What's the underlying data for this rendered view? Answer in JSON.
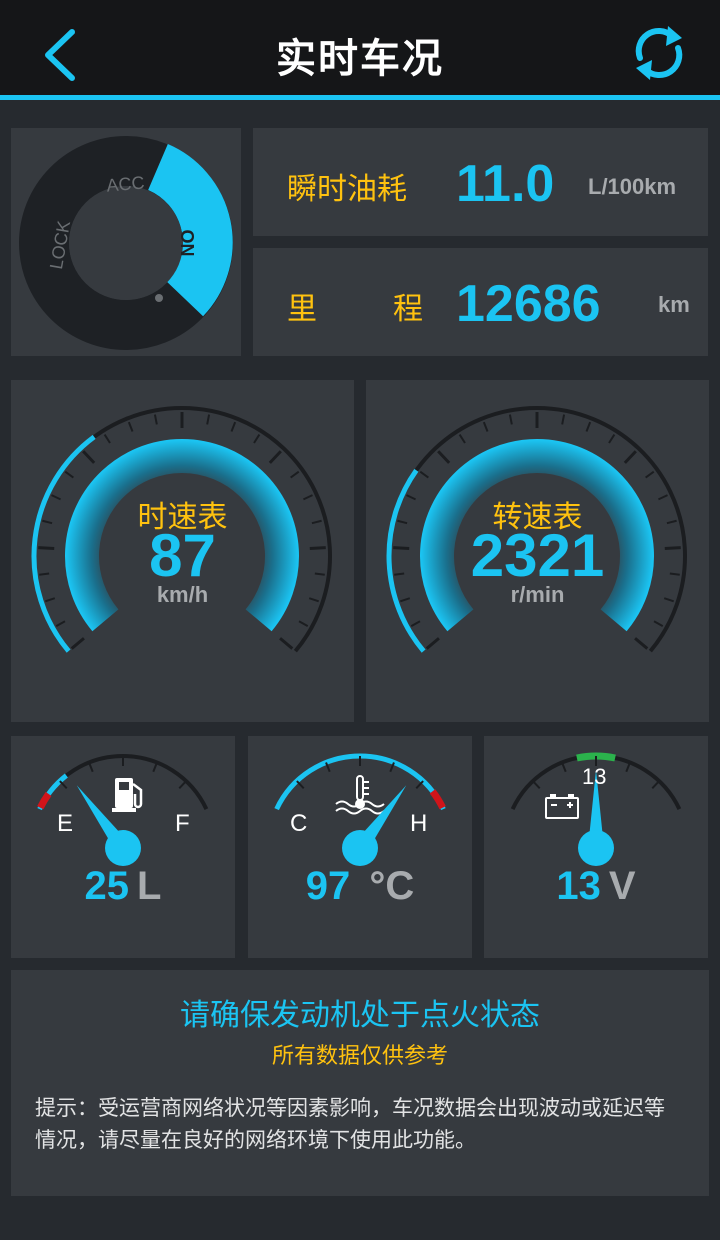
{
  "header": {
    "title": "实时车况",
    "back_icon": "chevron-left-icon",
    "refresh_icon": "refresh-icon"
  },
  "colors": {
    "accent": "#1bc4f2",
    "label": "#ffc20f",
    "panel": "#363a3f",
    "background": "#262a2f",
    "warning": "#d0141a",
    "ok": "#2bb24c"
  },
  "ignition": {
    "positions": [
      "LOCK",
      "ACC",
      "ON"
    ],
    "active": "ON"
  },
  "fuel_consumption": {
    "label": "瞬时油耗",
    "value": "11.0",
    "unit": "L/100km"
  },
  "odometer": {
    "label_left": "里",
    "label_right": "程",
    "value": "12686",
    "unit": "km"
  },
  "speedometer": {
    "title": "时速表",
    "value": "87",
    "unit": "km/h",
    "fraction": 0.36
  },
  "tachometer": {
    "title": "转速表",
    "value": "2321",
    "unit": "r/min",
    "fraction": 0.29
  },
  "fuel_tank": {
    "empty_label": "E",
    "full_label": "F",
    "value": "25",
    "unit": "L",
    "icon": "fuel-pump-icon",
    "fraction": 0.22
  },
  "coolant": {
    "cold_label": "C",
    "hot_label": "H",
    "value": "97 ",
    "unit": "°C",
    "icon": "coolant-temperature-icon",
    "fraction": 0.78
  },
  "battery": {
    "marker": "13",
    "value": "13",
    "unit": "V",
    "icon": "battery-icon",
    "fraction": 0.5
  },
  "notice": {
    "main": "请确保发动机处于点火状态",
    "sub": "所有数据仅供参考",
    "tip": "提示：受运营商网络状况等因素影响，车况数据会出现波动或延迟等情况，请尽量在良好的网络环境下使用此功能。"
  }
}
